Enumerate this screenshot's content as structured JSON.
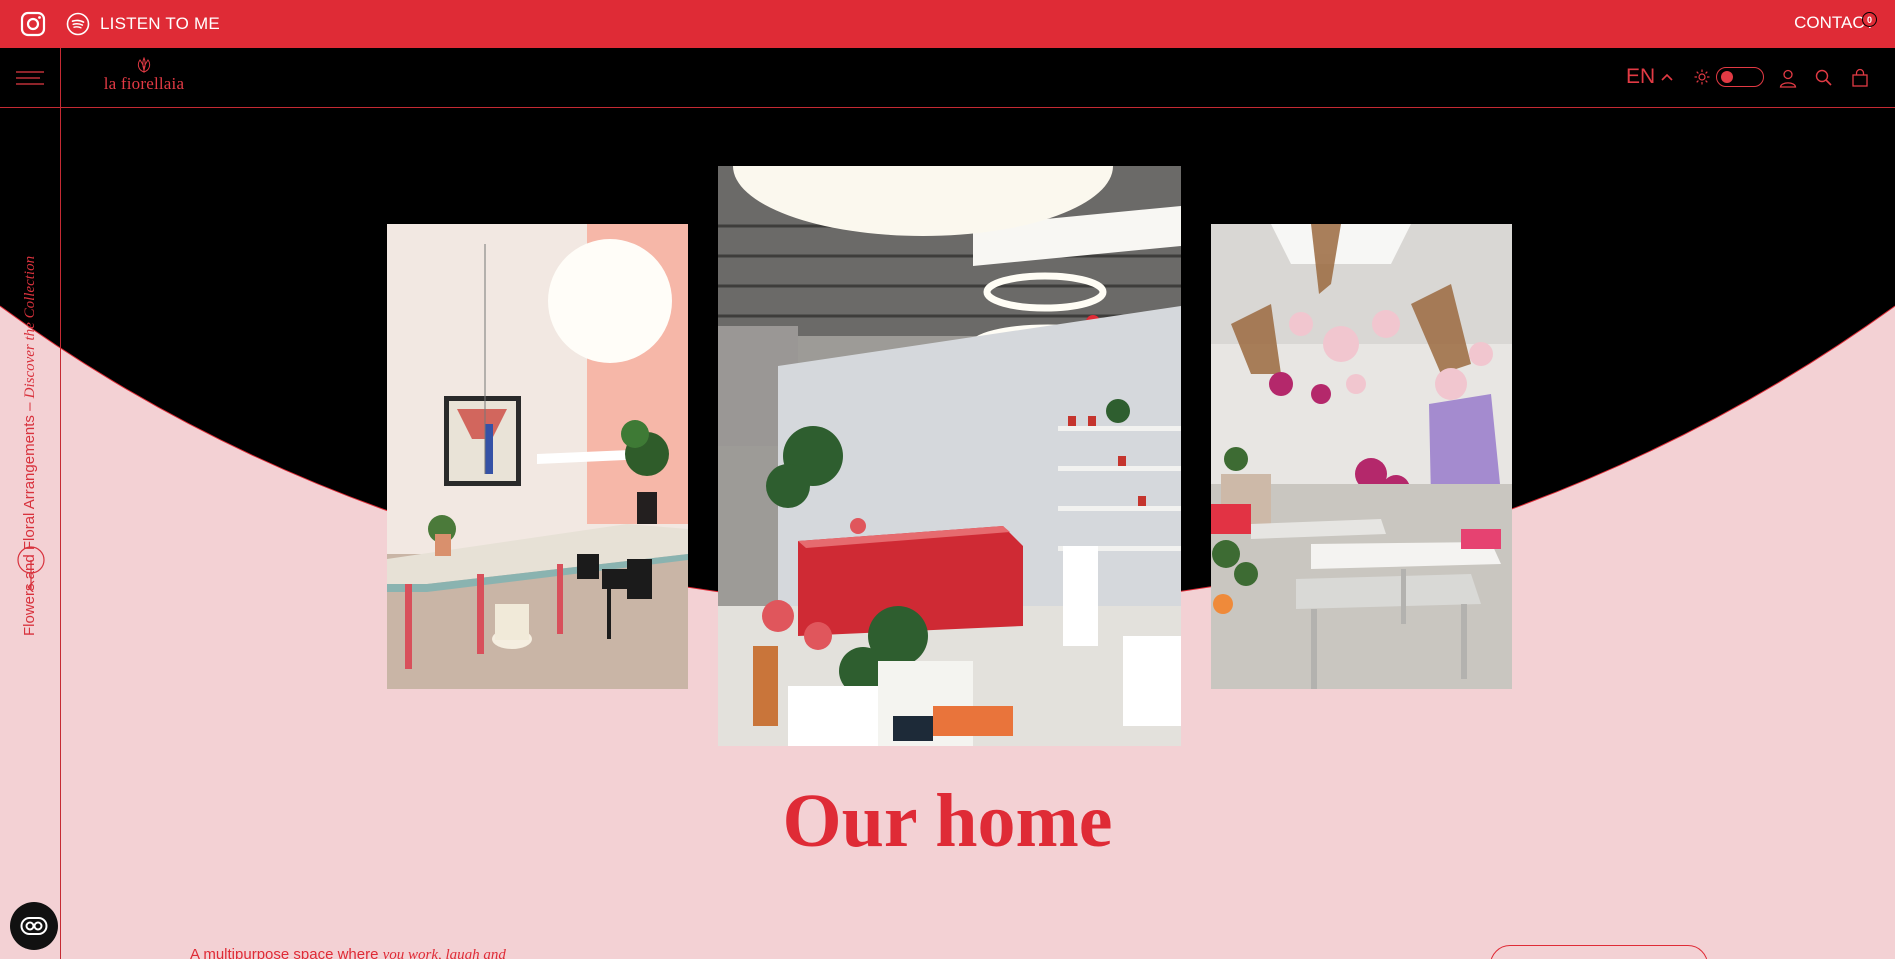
{
  "topbar": {
    "listen_label": "LISTEN TO ME",
    "contact_label": "CONTACT"
  },
  "header": {
    "brand": "la fiorellaia",
    "language": "EN",
    "cart_count": "0"
  },
  "rail": {
    "vertical_text_plain": "Flowers and Floral Arrangements – ",
    "vertical_text_italic": "Discover the Collection"
  },
  "main": {
    "title": "Our home",
    "desc_plain": "A multipurpose space where ",
    "desc_italic": "you work, laugh and"
  },
  "colors": {
    "brand_red": "#df2b36",
    "background_pink": "#f3d1d4",
    "header_black": "#000000"
  },
  "icons": [
    "instagram-icon",
    "spotify-icon",
    "hamburger-menu-icon",
    "chevron-up-icon",
    "sun-icon",
    "user-icon",
    "search-icon",
    "cart-icon",
    "arrow-left-icon",
    "chat-icon"
  ]
}
